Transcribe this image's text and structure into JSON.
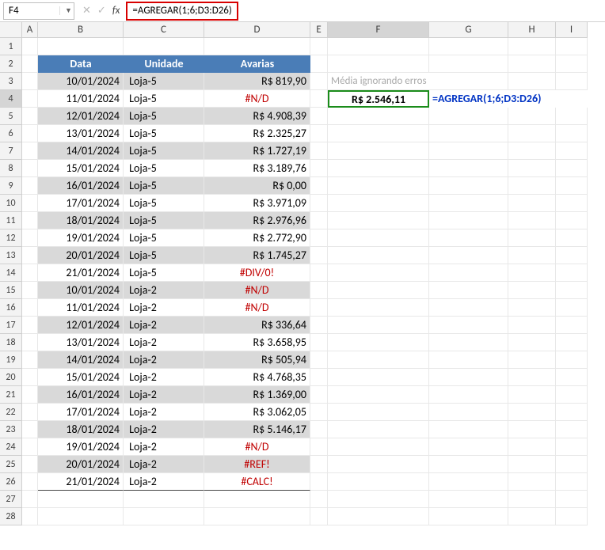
{
  "name_box": "F4",
  "formula_bar": "=AGREGAR(1;6;D3:D26)",
  "fx_label": "fx",
  "columns": [
    "A",
    "B",
    "C",
    "D",
    "E",
    "F",
    "G",
    "H",
    "I"
  ],
  "table_headers": {
    "data": "Data",
    "unidade": "Unidade",
    "avarias": "Avarias"
  },
  "note": "Média ignorando erros",
  "result_value": "R$ 2.546,11",
  "result_formula": "=AGREGAR(1;6;D3:D26)",
  "rows": [
    {
      "r": 3,
      "data": "10/01/2024",
      "unidade": "Loja-5",
      "avarias": "R$ 819,90",
      "err": false,
      "band": 0
    },
    {
      "r": 4,
      "data": "11/01/2024",
      "unidade": "Loja-5",
      "avarias": "#N/D",
      "err": true,
      "band": 1
    },
    {
      "r": 5,
      "data": "12/01/2024",
      "unidade": "Loja-5",
      "avarias": "R$ 4.908,39",
      "err": false,
      "band": 0
    },
    {
      "r": 6,
      "data": "13/01/2024",
      "unidade": "Loja-5",
      "avarias": "R$ 2.325,27",
      "err": false,
      "band": 1
    },
    {
      "r": 7,
      "data": "14/01/2024",
      "unidade": "Loja-5",
      "avarias": "R$ 1.727,19",
      "err": false,
      "band": 0
    },
    {
      "r": 8,
      "data": "15/01/2024",
      "unidade": "Loja-5",
      "avarias": "R$ 3.189,76",
      "err": false,
      "band": 1
    },
    {
      "r": 9,
      "data": "16/01/2024",
      "unidade": "Loja-5",
      "avarias": "R$ 0,00",
      "err": false,
      "band": 0
    },
    {
      "r": 10,
      "data": "17/01/2024",
      "unidade": "Loja-5",
      "avarias": "R$ 3.971,09",
      "err": false,
      "band": 1
    },
    {
      "r": 11,
      "data": "18/01/2024",
      "unidade": "Loja-5",
      "avarias": "R$ 2.976,96",
      "err": false,
      "band": 0
    },
    {
      "r": 12,
      "data": "19/01/2024",
      "unidade": "Loja-5",
      "avarias": "R$ 2.772,90",
      "err": false,
      "band": 1
    },
    {
      "r": 13,
      "data": "20/01/2024",
      "unidade": "Loja-5",
      "avarias": "R$ 1.745,27",
      "err": false,
      "band": 0
    },
    {
      "r": 14,
      "data": "21/01/2024",
      "unidade": "Loja-5",
      "avarias": "#DIV/0!",
      "err": true,
      "band": 1
    },
    {
      "r": 15,
      "data": "10/01/2024",
      "unidade": "Loja-2",
      "avarias": "#N/D",
      "err": true,
      "band": 0
    },
    {
      "r": 16,
      "data": "11/01/2024",
      "unidade": "Loja-2",
      "avarias": "#N/D",
      "err": true,
      "band": 1
    },
    {
      "r": 17,
      "data": "12/01/2024",
      "unidade": "Loja-2",
      "avarias": "R$ 336,64",
      "err": false,
      "band": 0
    },
    {
      "r": 18,
      "data": "13/01/2024",
      "unidade": "Loja-2",
      "avarias": "R$ 3.658,95",
      "err": false,
      "band": 1
    },
    {
      "r": 19,
      "data": "14/01/2024",
      "unidade": "Loja-2",
      "avarias": "R$ 505,94",
      "err": false,
      "band": 0
    },
    {
      "r": 20,
      "data": "15/01/2024",
      "unidade": "Loja-2",
      "avarias": "R$ 4.768,35",
      "err": false,
      "band": 1
    },
    {
      "r": 21,
      "data": "16/01/2024",
      "unidade": "Loja-2",
      "avarias": "R$ 1.369,00",
      "err": false,
      "band": 0
    },
    {
      "r": 22,
      "data": "17/01/2024",
      "unidade": "Loja-2",
      "avarias": "R$ 3.062,05",
      "err": false,
      "band": 1
    },
    {
      "r": 23,
      "data": "18/01/2024",
      "unidade": "Loja-2",
      "avarias": "R$ 5.146,17",
      "err": false,
      "band": 0
    },
    {
      "r": 24,
      "data": "19/01/2024",
      "unidade": "Loja-2",
      "avarias": "#N/D",
      "err": true,
      "band": 1
    },
    {
      "r": 25,
      "data": "20/01/2024",
      "unidade": "Loja-2",
      "avarias": "#REF!",
      "err": true,
      "band": 0
    },
    {
      "r": 26,
      "data": "21/01/2024",
      "unidade": "Loja-2",
      "avarias": "#CALC!",
      "err": true,
      "band": 1
    }
  ],
  "empty_rows": [
    1,
    27,
    28
  ]
}
